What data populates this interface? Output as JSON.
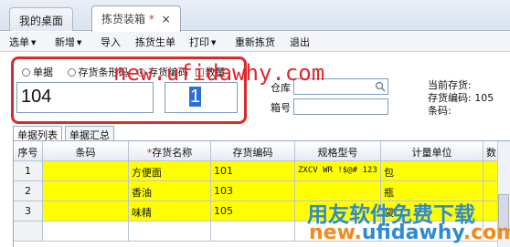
{
  "tabs": [
    {
      "label": "我的桌面"
    },
    {
      "label": "拣货装箱",
      "modified": "*",
      "close": "×"
    }
  ],
  "toolbar": {
    "select": "选单",
    "new": "新增",
    "import": "导入",
    "pick_generate": "拣货生单",
    "print": "打印",
    "repick": "重新拣货",
    "exit": "退出"
  },
  "scan": {
    "opt_doc": "单据",
    "opt_sku": "存货条形码",
    "opt_code": "存货编码",
    "opt_qty": "数量",
    "code_value": "104",
    "qty_value": "1",
    "warehouse_label": "仓库",
    "box_label": "箱号"
  },
  "info": {
    "current_item": "当前存货:",
    "item_code_label": "存货编码:",
    "item_code_value": "105",
    "barcode_label": "条码:"
  },
  "subtabs": [
    "单据列表",
    "单据汇总"
  ],
  "grid": {
    "headers": {
      "seq": "序号",
      "barcode": "条码",
      "name_req": "*",
      "name": "存货名称",
      "code": "存货编码",
      "spec": "规格型号",
      "unit": "计量单位",
      "qty": "数"
    },
    "rows": [
      {
        "seq": "1",
        "barcode": "",
        "name": "方便面",
        "code": "101",
        "spec": "ZXCV WR !$@# 123",
        "unit": "包"
      },
      {
        "seq": "2",
        "barcode": "",
        "name": "香油",
        "code": "103",
        "spec": "",
        "unit": "瓶"
      },
      {
        "seq": "3",
        "barcode": "",
        "name": "味精",
        "code": "105",
        "spec": "",
        "unit": "袋"
      }
    ]
  },
  "watermarks": {
    "top": "new.ufidawhy.com",
    "brand": "用友软件免费下载",
    "url_part1": "new.",
    "url_part2": "ufidawhy",
    "url_part3": ".com"
  },
  "colors": {
    "highlight": "#ffff00",
    "frame": "#d92b2b",
    "watermark_red": "#e2262c",
    "watermark_blue": "#2f8ad0",
    "watermark_orange": "#f08a1c"
  }
}
